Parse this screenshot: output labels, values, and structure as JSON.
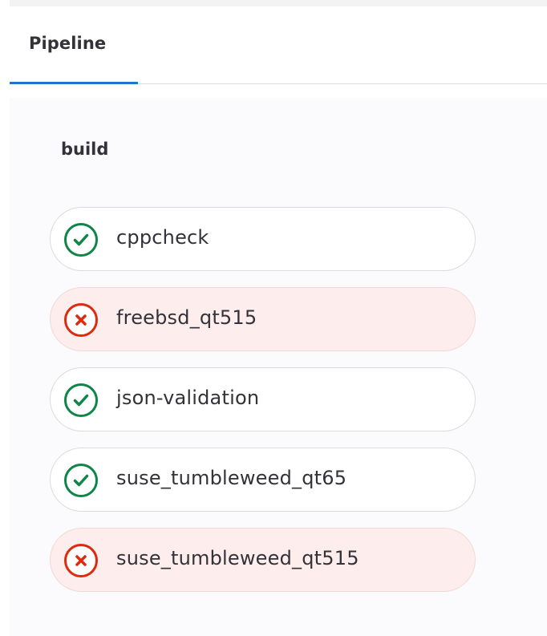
{
  "tabs": [
    {
      "label": "Pipeline",
      "active": true
    }
  ],
  "stage": {
    "title": "build"
  },
  "jobs": [
    {
      "name": "cppcheck",
      "status": "success",
      "icon": "check-circle-icon"
    },
    {
      "name": "freebsd_qt515",
      "status": "failed",
      "icon": "close-circle-icon"
    },
    {
      "name": "json-validation",
      "status": "success",
      "icon": "check-circle-icon"
    },
    {
      "name": "suse_tumbleweed_qt65",
      "status": "success",
      "icon": "check-circle-icon"
    },
    {
      "name": "suse_tumbleweed_qt515",
      "status": "failed",
      "icon": "close-circle-icon"
    }
  ],
  "colors": {
    "success": "#108548",
    "failed": "#dd2b0e",
    "failed_background": "#fdeeed",
    "active_tab": "#1f75cb"
  }
}
